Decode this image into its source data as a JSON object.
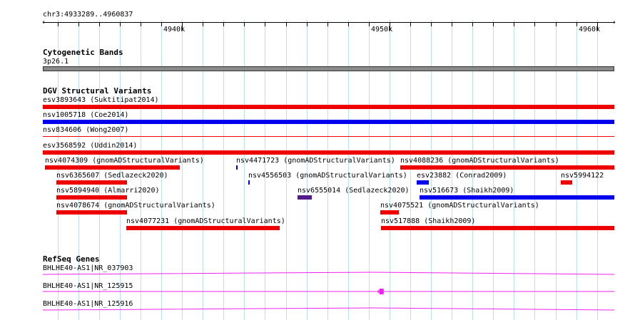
{
  "ruler": {
    "position_label": "chr3:4933289..4960837",
    "range": [
      4933289,
      4960837
    ],
    "tick_labels": [
      {
        "label": "4940k",
        "pos": 4940000
      },
      {
        "label": "4950k",
        "pos": 4950000
      },
      {
        "label": "4960k",
        "pos": 4960000
      }
    ],
    "minor_tick_step": 1000,
    "grid_step": 1000
  },
  "cytoband_track": {
    "title": "Cytogenetic Bands",
    "band_label": "3p26.1",
    "band_color": "#8a8a8a"
  },
  "dgv_track": {
    "title": "DGV Structural Variants",
    "colors": {
      "loss": "#ee0000",
      "gain": "#0000ee",
      "complex": "#551a8b"
    },
    "features": [
      {
        "label": "esv3893643 (Suktitipat2014)",
        "start": 4933289,
        "end": 4960837,
        "type": "loss",
        "row": 0
      },
      {
        "label": "nsv1005718 (Coe2014)",
        "start": 4933289,
        "end": 4960837,
        "type": "gain",
        "row": 1
      },
      {
        "label": "nsv834606 (Wong2007)",
        "start": 4933289,
        "end": 4960837,
        "type": "loss_thin",
        "row": 2
      },
      {
        "label": "esv3568592 (Uddin2014)",
        "start": 4933289,
        "end": 4960837,
        "type": "loss",
        "row": 3
      },
      {
        "label": "nsv4074309 (gnomADStructuralVariants)",
        "start": 4933400,
        "end": 4939900,
        "type": "loss",
        "row": 4
      },
      {
        "label": "nsv4471723 (gnomADStructuralVariants)",
        "start": 4942620,
        "end": 4942700,
        "type": "gain",
        "row": 4
      },
      {
        "label": "nsv4088236 (gnomADStructuralVariants)",
        "start": 4950520,
        "end": 4960837,
        "type": "loss",
        "row": 4
      },
      {
        "label": "nsv6365607 (Sedlazeck2020)",
        "start": 4933950,
        "end": 4937350,
        "type": "loss",
        "row": 5
      },
      {
        "label": "nsv4556503 (gnomADStructuralVariants)",
        "start": 4943200,
        "end": 4943280,
        "type": "gain",
        "row": 5
      },
      {
        "label": "esv23882 (Conrad2009)",
        "start": 4951300,
        "end": 4951900,
        "type": "gain",
        "row": 5
      },
      {
        "label": "nsv5994122",
        "start": 4958250,
        "end": 4958800,
        "type": "loss",
        "row": 5
      },
      {
        "label": "nsv5894940 (Almarri2020)",
        "start": 4933950,
        "end": 4937350,
        "type": "loss",
        "row": 6
      },
      {
        "label": "nsv6555014 (Sedlazeck2020)",
        "start": 4945550,
        "end": 4946250,
        "type": "complex",
        "row": 6
      },
      {
        "label": "nsv516673 (Shaikh2009)",
        "start": 4951450,
        "end": 4960837,
        "type": "gain",
        "row": 6
      },
      {
        "label": "nsv4078674 (gnomADStructuralVariants)",
        "start": 4933950,
        "end": 4937350,
        "type": "loss",
        "row": 7
      },
      {
        "label": "nsv4075521 (gnomADStructuralVariants)",
        "start": 4949550,
        "end": 4950450,
        "type": "loss",
        "row": 7
      },
      {
        "label": "nsv4077231 (gnomADStructuralVariants)",
        "start": 4937300,
        "end": 4944700,
        "type": "loss",
        "row": 8
      },
      {
        "label": "nsv517888 (Shaikh2009)",
        "start": 4949600,
        "end": 4960837,
        "type": "loss",
        "row": 8
      }
    ]
  },
  "refseq_track": {
    "title": "RefSeq Genes",
    "color": "#ee22ee",
    "genes": [
      {
        "label": "BHLHE40-AS1|NR_037903",
        "row": 0,
        "exons": []
      },
      {
        "label": "BHLHE40-AS1|NR_125915",
        "row": 1,
        "exons": [
          {
            "start": 4949520,
            "end": 4949720
          }
        ],
        "arrow_at": 4949420
      },
      {
        "label": "BHLHE40-AS1|NR_125916",
        "row": 2,
        "exons": []
      }
    ]
  }
}
